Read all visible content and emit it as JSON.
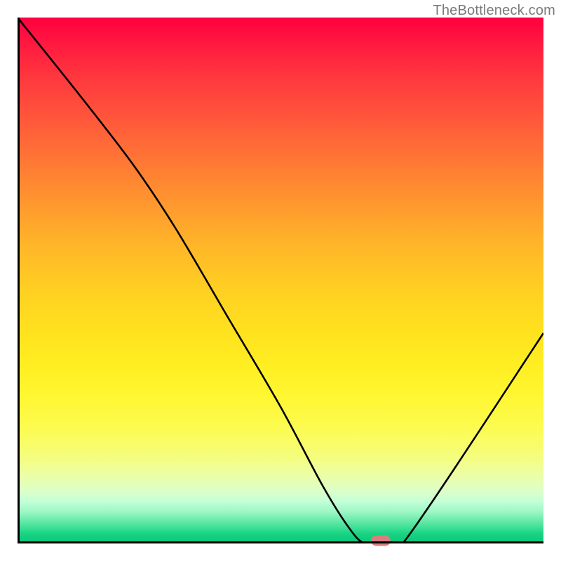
{
  "watermark": "TheBottleneck.com",
  "colors": {
    "marker": "#d97d7d",
    "curve": "#000000"
  },
  "chart_data": {
    "type": "line",
    "title": "",
    "xlabel": "",
    "ylabel": "",
    "xlim": [
      0,
      100
    ],
    "ylim": [
      0,
      100
    ],
    "grid": false,
    "legend": false,
    "series": [
      {
        "name": "bottleneck-curve",
        "x": [
          0,
          12,
          22,
          30,
          40,
          50,
          58,
          63,
          66,
          70,
          74,
          100
        ],
        "values": [
          100,
          85,
          72,
          60,
          43,
          26,
          11,
          3,
          0,
          0,
          1,
          40
        ]
      }
    ],
    "annotations": [
      {
        "name": "optimal-point",
        "x": 69,
        "y": 0.6
      }
    ]
  }
}
